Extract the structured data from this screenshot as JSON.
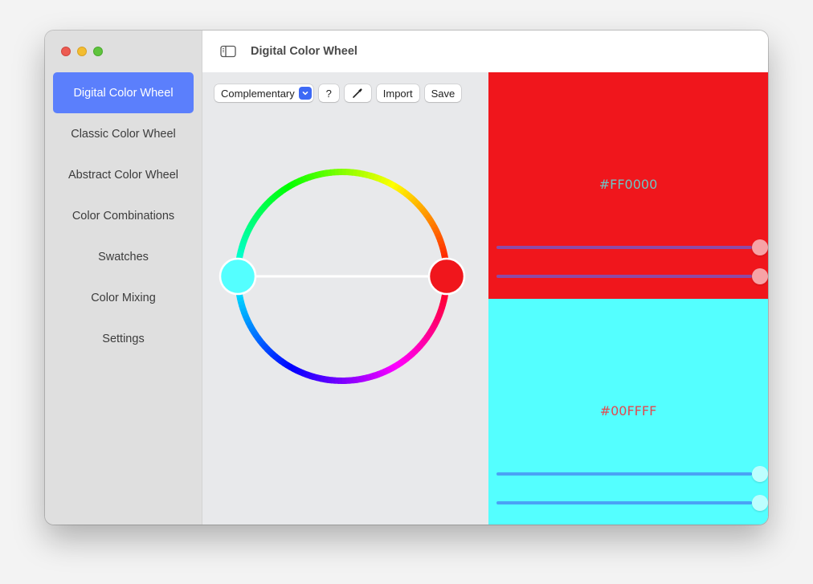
{
  "window": {
    "title": "Digital Color Wheel",
    "traffic_lights": [
      "close",
      "minimize",
      "maximize"
    ]
  },
  "sidebar": {
    "items": [
      {
        "label": "Digital Color Wheel",
        "active": true
      },
      {
        "label": "Classic Color Wheel",
        "active": false
      },
      {
        "label": "Abstract Color Wheel",
        "active": false
      },
      {
        "label": "Color Combinations",
        "active": false
      },
      {
        "label": "Swatches",
        "active": false
      },
      {
        "label": "Color Mixing",
        "active": false
      },
      {
        "label": "Settings",
        "active": false
      }
    ],
    "accent": "#5b7ffc"
  },
  "toolbar": {
    "scheme_select": {
      "value": "Complementary"
    },
    "help_label": "?",
    "eyedropper_icon": "eyedropper-icon",
    "import_label": "Import",
    "save_label": "Save"
  },
  "wheel": {
    "scheme": "Complementary",
    "handles": [
      {
        "color": "#54ffff",
        "hue_deg": 180
      },
      {
        "color": "#f0161c",
        "hue_deg": 0
      }
    ]
  },
  "colors": [
    {
      "hex_label": "#FF0000",
      "background": "#f0161c",
      "label_color": "#6fc4c4",
      "track_color": "#8e4aa6",
      "thumb_color": "#f7a3a6",
      "sliders": [
        {
          "value": 1.0
        },
        {
          "value": 1.0
        }
      ]
    },
    {
      "hex_label": "#00FFFF",
      "background": "#54ffff",
      "label_color": "#e04a50",
      "track_color": "#4aa2f5",
      "thumb_color": "#bdffff",
      "sliders": [
        {
          "value": 1.0
        },
        {
          "value": 1.0
        }
      ]
    }
  ]
}
